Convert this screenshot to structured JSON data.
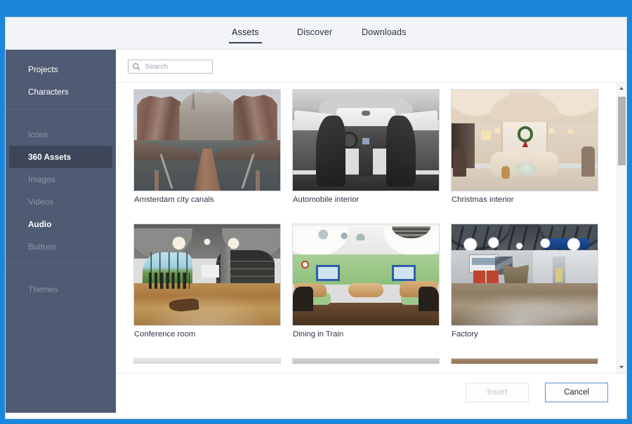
{
  "window": {
    "frame_color": "#1b87dc",
    "dialog_bg": "#ffffff"
  },
  "tabs": [
    {
      "id": "assets",
      "label": "Assets",
      "active": true
    },
    {
      "id": "discover",
      "label": "Discover",
      "active": false
    },
    {
      "id": "downloads",
      "label": "Downloads",
      "active": false
    }
  ],
  "sidebar": {
    "bg_color": "#4f5a73",
    "selected_color": "#3d4659",
    "groups": [
      {
        "items": [
          {
            "label": "Projects",
            "state": "normal"
          },
          {
            "label": "Characters",
            "state": "normal"
          }
        ]
      },
      {
        "items": [
          {
            "label": "Icons",
            "state": "dim"
          },
          {
            "label": "360 Assets",
            "state": "selected"
          },
          {
            "label": "Images",
            "state": "dim"
          },
          {
            "label": "Videos",
            "state": "dim"
          },
          {
            "label": "Audio",
            "state": "strong"
          },
          {
            "label": "Buttons",
            "state": "dim"
          }
        ]
      },
      {
        "items": [
          {
            "label": "Themes",
            "state": "dim"
          }
        ]
      }
    ]
  },
  "search": {
    "placeholder": "Search",
    "value": "",
    "icon": "search-icon"
  },
  "assets": {
    "rows": [
      [
        {
          "label": "Amsterdam city canals",
          "art": "amsterdam"
        },
        {
          "label": "Automobile interior",
          "art": "automobile"
        },
        {
          "label": "Christmas interior",
          "art": "christmas"
        }
      ],
      [
        {
          "label": "Conference room",
          "art": "conference"
        },
        {
          "label": "Dining in Train",
          "art": "dining"
        },
        {
          "label": "Factory",
          "art": "factory"
        }
      ]
    ]
  },
  "scrollbar": {
    "up_icon": "scroll-up-arrow-icon",
    "down_icon": "scroll-down-arrow-icon",
    "thumb_position": "top"
  },
  "footer": {
    "insert_label": "Insert",
    "insert_enabled": false,
    "cancel_label": "Cancel",
    "cancel_focus_color": "#5a8fd6"
  }
}
